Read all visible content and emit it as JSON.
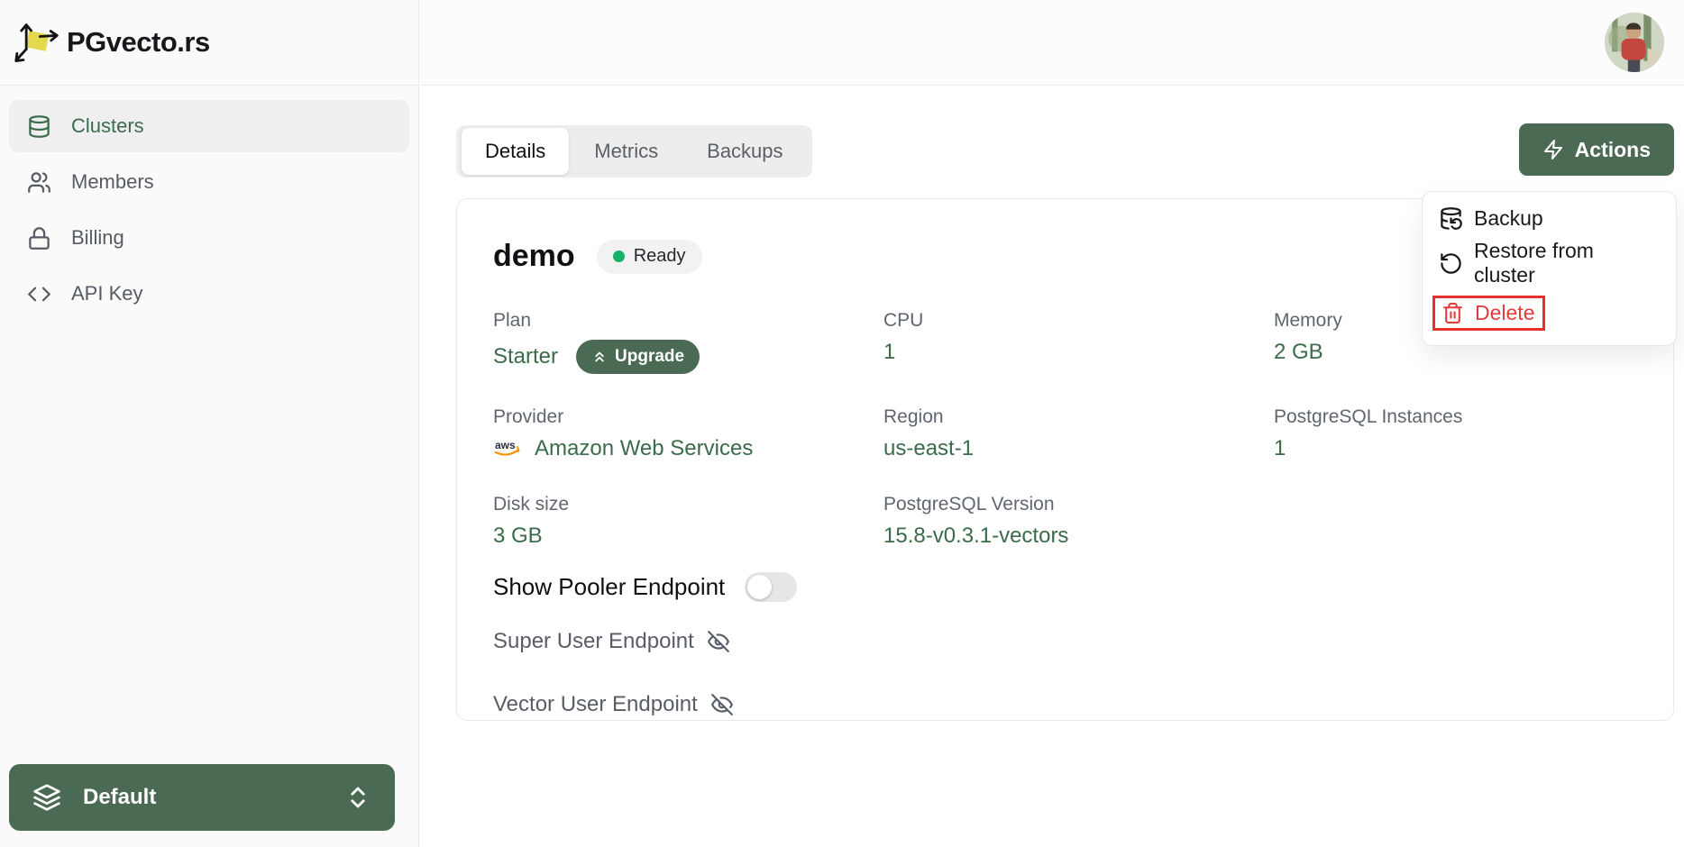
{
  "app": {
    "title": "PGvecto.rs"
  },
  "sidebar": {
    "items": [
      {
        "label": "Clusters",
        "icon": "database-icon",
        "active": true
      },
      {
        "label": "Members",
        "icon": "users-icon",
        "active": false
      },
      {
        "label": "Billing",
        "icon": "lock-icon",
        "active": false
      },
      {
        "label": "API Key",
        "icon": "code-icon",
        "active": false
      }
    ],
    "workspace": {
      "label": "Default",
      "icon": "layers-icon"
    }
  },
  "tabs": {
    "details": "Details",
    "metrics": "Metrics",
    "backups": "Backups",
    "active": "Details"
  },
  "actions": {
    "button_label": "Actions",
    "menu": {
      "backup": "Backup",
      "restore": "Restore from cluster",
      "delete": "Delete",
      "highlighted_item": "Delete"
    }
  },
  "cluster": {
    "name": "demo",
    "status": "Ready",
    "plan": {
      "label": "Plan",
      "value": "Starter",
      "upgrade_label": "Upgrade"
    },
    "cpu": {
      "label": "CPU",
      "value": "1"
    },
    "memory": {
      "label": "Memory",
      "value": "2 GB"
    },
    "provider": {
      "label": "Provider",
      "value": "Amazon Web Services",
      "icon": "aws-logo"
    },
    "region": {
      "label": "Region",
      "value": "us-east-1"
    },
    "instances": {
      "label": "PostgreSQL Instances",
      "value": "1"
    },
    "disk": {
      "label": "Disk size",
      "value": "3 GB"
    },
    "version": {
      "label": "PostgreSQL Version",
      "value": "15.8-v0.3.1-vectors"
    },
    "pooler": {
      "label": "Show Pooler Endpoint",
      "enabled": false
    },
    "endpoints": [
      {
        "label": "Super User Endpoint"
      },
      {
        "label": "Vector User Endpoint"
      }
    ]
  },
  "colors": {
    "brand_green": "#4b6a53",
    "value_green": "#3a6b4a",
    "danger_red": "#e23b3c",
    "highlight_border": "#e5322e",
    "ready_dot": "#17b26a",
    "aws_orange": "#f79400"
  }
}
